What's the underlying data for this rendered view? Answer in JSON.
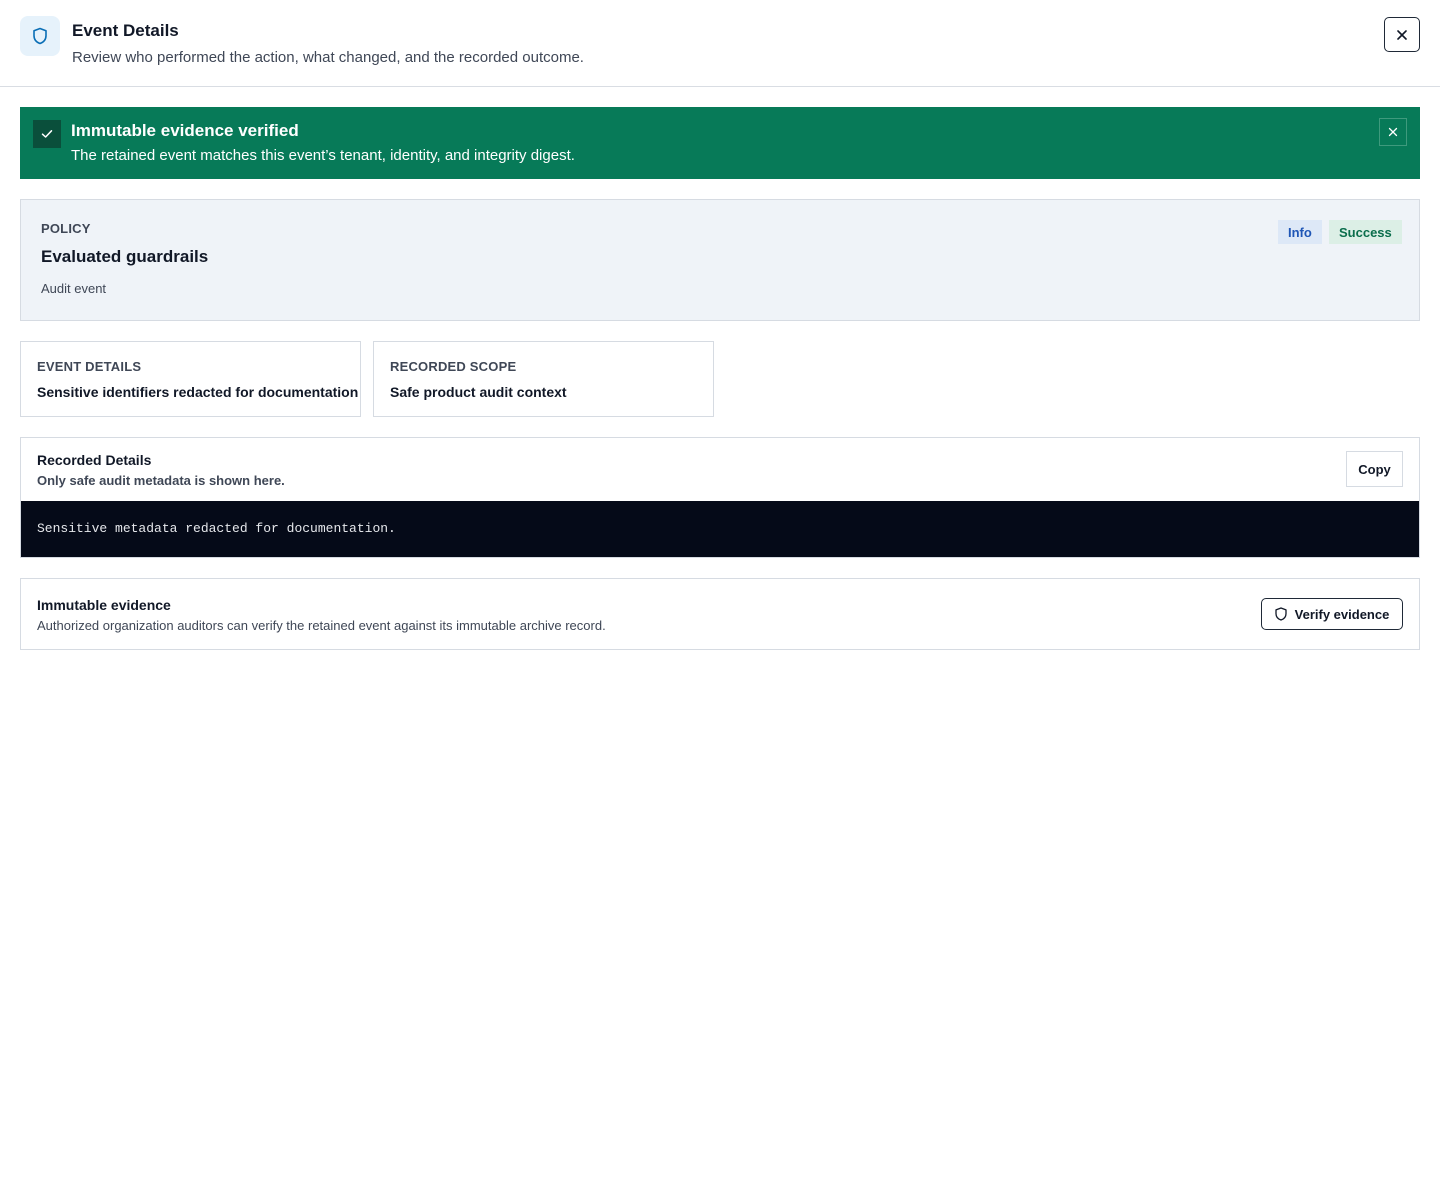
{
  "header": {
    "title": "Event Details",
    "subtitle": "Review who performed the action, what changed, and the recorded outcome.",
    "icon": "shield-icon",
    "close_icon": "close-icon"
  },
  "banner": {
    "title": "Immutable evidence verified",
    "text": "The retained event matches this event’s tenant, identity, and integrity digest.",
    "color": "#077a58"
  },
  "policy": {
    "label": "POLICY",
    "title": "Evaluated guardrails",
    "subtitle": "Audit event",
    "badges": [
      "Info",
      "Success"
    ]
  },
  "cards": [
    {
      "label": "EVENT DETAILS",
      "value": "Sensitive identifiers redacted for documentation"
    },
    {
      "label": "RECORDED SCOPE",
      "value": "Safe product audit context"
    }
  ],
  "recorded_details": {
    "title": "Recorded Details",
    "subtitle": "Only safe audit metadata is shown here.",
    "copy_label": "Copy",
    "code": "Sensitive metadata redacted for documentation."
  },
  "evidence": {
    "title": "Immutable evidence",
    "subtitle": "Authorized organization auditors can verify the retained event against its immutable archive record.",
    "verify_label": "Verify evidence"
  }
}
